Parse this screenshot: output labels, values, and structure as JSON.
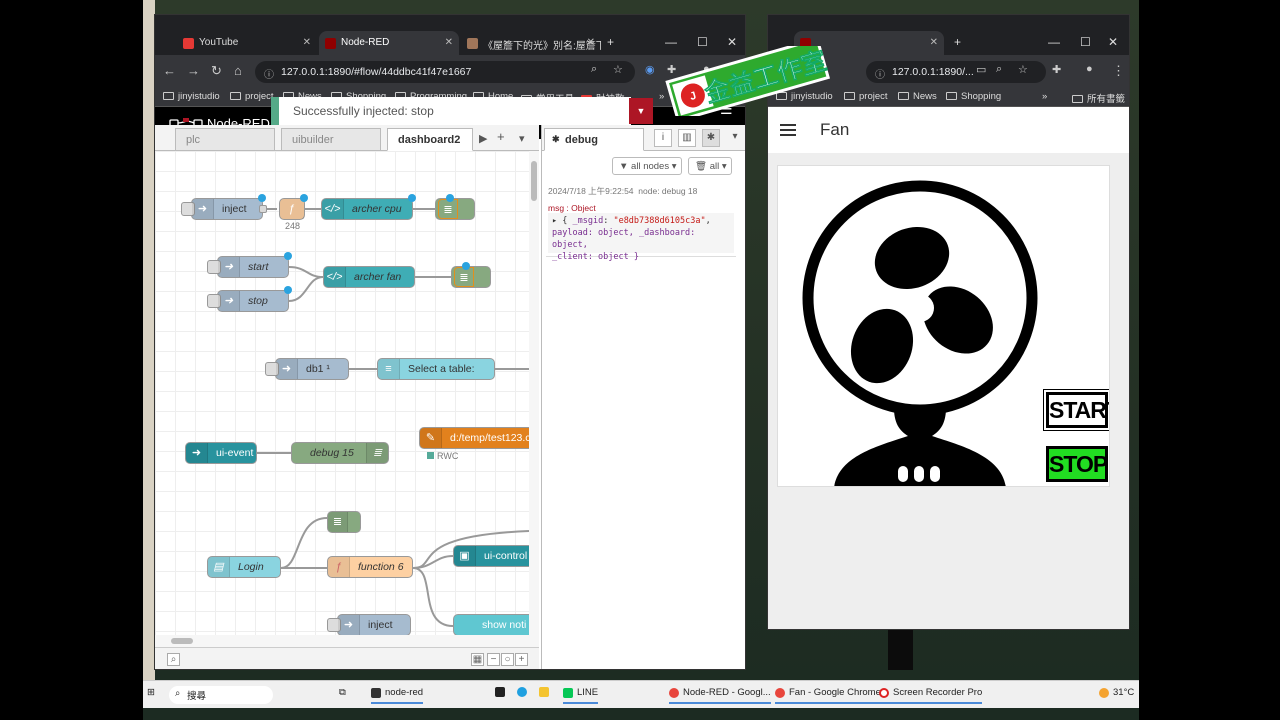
{
  "left_window": {
    "tabs": [
      {
        "label": "YouTube",
        "color": "#e53935"
      },
      {
        "label": "Node-RED",
        "color": "#8f0000",
        "active": true
      },
      {
        "label": "《屋簷下的光》別名:屋簷下",
        "color": "#a0765a"
      }
    ],
    "url": "127.0.0.1:1890/#flow/44ddbc41f47e1667",
    "bookmarks": [
      "jinyistudio",
      "project",
      "News",
      "Shopping",
      "Programming",
      "Home",
      "常用工具",
      "財神敬"
    ],
    "nodered": {
      "title": "Node-RED",
      "notification": "Successfully injected: stop",
      "workspace_tabs": [
        "plc",
        "uibuilder",
        "dashboard2"
      ],
      "nodes": {
        "inject1": "inject",
        "func_count": "248",
        "archer_cpu": "archer cpu",
        "start": "start",
        "stop": "stop",
        "archer_fan": "archer fan",
        "db1": "db1 ¹",
        "select_table": "Select a table:",
        "ui_event": "ui-event",
        "debug15": "debug 15",
        "file": "d:/temp/test123.c",
        "rwc": "RWC",
        "login": "Login",
        "function6": "function 6",
        "ui_control": "ui-control",
        "inject2": "inject",
        "show_noti": "show noti"
      },
      "sidebar": {
        "tab": "debug",
        "filter_nodes": "all nodes",
        "filter_all": "all",
        "message": {
          "time": "2024/7/18 上午9:22:54",
          "node": "node: debug 18",
          "type": "msg : Object",
          "line1_key": "_msgid",
          "line1_val": "\"e8db7388d6105c3a\"",
          "line2": "payload: object, _dashboard: object,",
          "line3": "_client: object }"
        }
      }
    }
  },
  "right_window": {
    "url": "127.0.0.1:1890/...",
    "bookmarks": [
      "jinyistudio",
      "project",
      "News",
      "Shopping",
      "所有書籤"
    ],
    "title": "Fan",
    "start_label": "START",
    "stop_label": "STOP",
    "stop_color": "#22dd22"
  },
  "watermark": "金益工作室",
  "taskbar": {
    "search": "搜尋",
    "items": [
      "node-red",
      "LINE",
      "Node-RED - Googl...",
      "Fan - Google Chrome",
      "Screen Recorder Pro"
    ],
    "temp": "31°C"
  }
}
